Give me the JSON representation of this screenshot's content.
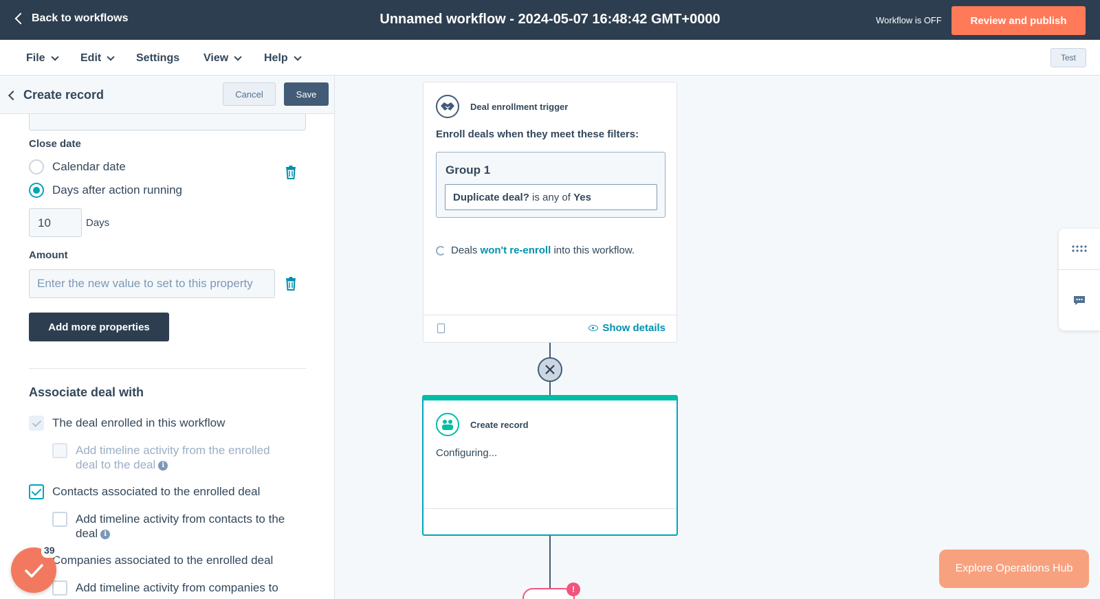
{
  "header": {
    "back_label": "Back to workflows",
    "title": "Unnamed workflow - 2024-05-07 16:48:42 GMT+0000",
    "status": "Workflow is OFF",
    "publish_label": "Review and publish"
  },
  "menu": {
    "items": [
      {
        "label": "File"
      },
      {
        "label": "Edit"
      },
      {
        "label": "Settings"
      },
      {
        "label": "View"
      },
      {
        "label": "Help"
      }
    ],
    "test_label": "Test"
  },
  "panel": {
    "title": "Create record",
    "cancel_label": "Cancel",
    "save_label": "Save",
    "close_date": {
      "label": "Close date",
      "options": [
        "Calendar date",
        "Days after action running"
      ],
      "selected": "Days after action running",
      "days_value": "10",
      "days_unit": "Days"
    },
    "amount": {
      "label": "Amount",
      "placeholder": "Enter the new value to set to this property"
    },
    "add_properties_label": "Add more properties",
    "associate": {
      "title": "Associate deal with",
      "items": [
        {
          "label": "The deal enrolled in this workflow",
          "state": "checked-disabled",
          "info": false
        },
        {
          "label": "Add timeline activity from the enrolled deal to the deal",
          "state": "disabled",
          "info": true
        },
        {
          "label": "Contacts associated to the enrolled deal",
          "state": "checked",
          "info": false
        },
        {
          "label": "Add timeline activity from contacts to the deal",
          "state": "unchecked",
          "info": true
        },
        {
          "label": "Companies associated to the enrolled deal",
          "state": "hidden-by-badge",
          "info": false
        },
        {
          "label": "Add timeline activity from companies to",
          "state": "unchecked",
          "info": false
        }
      ]
    }
  },
  "badge": {
    "count": "39"
  },
  "canvas": {
    "trigger": {
      "title": "Deal enrollment trigger",
      "enroll_text": "Enroll deals when they meet these filters:",
      "group_title": "Group 1",
      "filter_property": "Duplicate deal?",
      "filter_operator": "is any of",
      "filter_value": "Yes",
      "reenroll_prefix": "Deals",
      "reenroll_link": "won't re-enroll",
      "reenroll_suffix": "into this workflow.",
      "show_details_label": "Show details"
    },
    "action": {
      "title": "Create record",
      "status": "Configuring..."
    },
    "alert_mark": "!"
  },
  "explore_label": "Explore Operations Hub",
  "colors": {
    "header_bg": "#2d3e50",
    "accent_orange": "#ff7a59",
    "teal": "#00a4bd",
    "link": "#0091ae"
  }
}
